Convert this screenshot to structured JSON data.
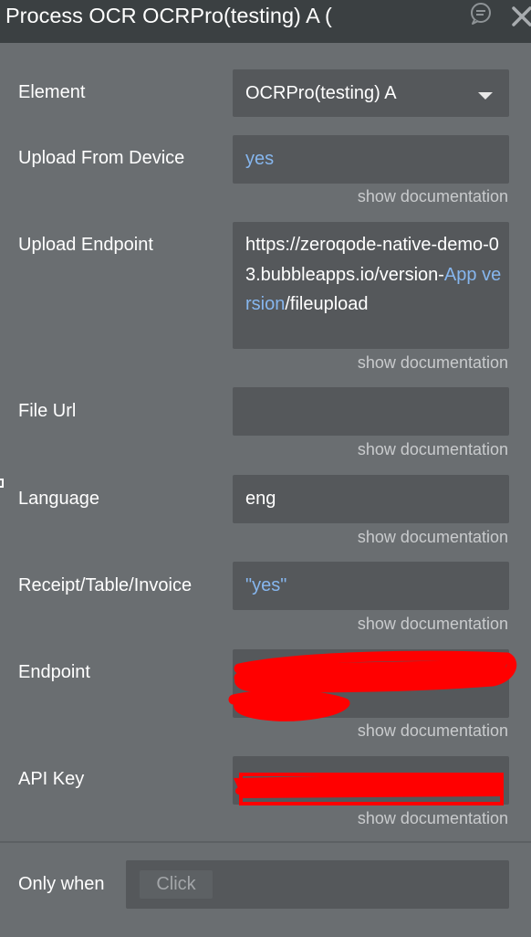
{
  "header": {
    "title": "Process OCR OCRPro(testing) A ("
  },
  "icons": {
    "comment": "comment-icon",
    "close": "close-icon",
    "caret": "chevron-down-icon"
  },
  "fields": {
    "element": {
      "label": "Element",
      "value": "OCRPro(testing) A"
    },
    "upload_from_device": {
      "label": "Upload From Device",
      "value": "yes"
    },
    "upload_endpoint": {
      "label": "Upload Endpoint",
      "value_prefix": "https://zeroqode-native-demo-03.bubbleapps.io/version-",
      "value_dynamic": "App version",
      "value_suffix": "/fileupload"
    },
    "file_url": {
      "label": "File Url",
      "value": ""
    },
    "language": {
      "label": "Language",
      "value": "eng"
    },
    "receipt": {
      "label": "Receipt/Table/Invoice",
      "value": "\"yes\""
    },
    "endpoint": {
      "label": "Endpoint",
      "value": ""
    },
    "api_key": {
      "label": "API Key",
      "value": ""
    }
  },
  "documentation_link": "show documentation",
  "condition": {
    "label": "Only when",
    "button_label": "Click"
  },
  "colors": {
    "panel_bg": "#6a6e71",
    "titlebar_bg": "#3b4042",
    "field_bg": "#55585b",
    "dynamic_value": "#86b6ee",
    "redaction": "#ff0000"
  }
}
